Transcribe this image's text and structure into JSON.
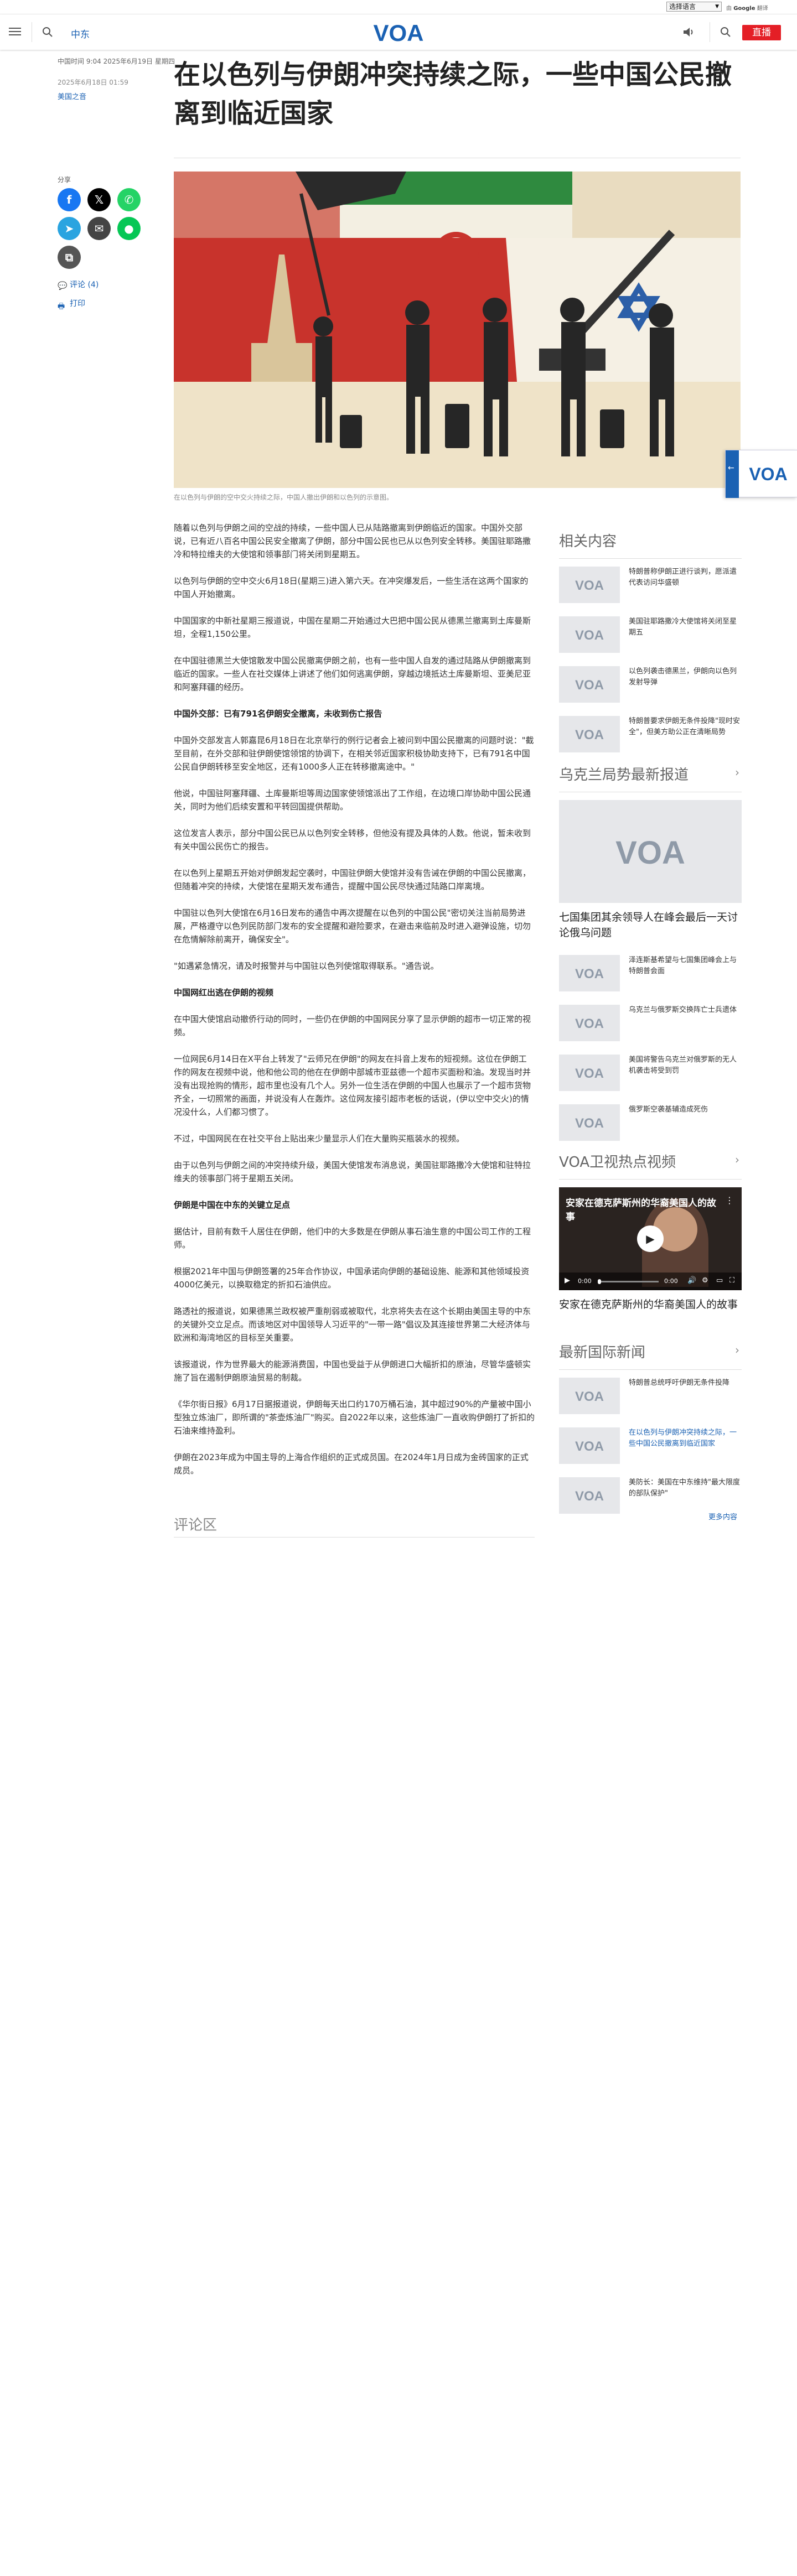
{
  "lang": {
    "selected": "选择语言",
    "powered_by": "Google",
    "translate": "翻译"
  },
  "header": {
    "section": "中东",
    "live": "直播",
    "logo": "VOA"
  },
  "article": {
    "meta_top": "中国时间 9:04 2025年6月19日 星期四",
    "date": "2025年6月18日 01:59",
    "category": "美国之音",
    "title": "在以色列与伊朗冲突持续之际，一些中国公民撤离到临近国家",
    "share_label": "分享",
    "comments_link": "评论 (4)",
    "print_link": "打印",
    "caption": "在以色列与伊朗的空中交火持续之际，中国人撤出伊朗和以色列的示意图。",
    "paragraphs": [
      {
        "type": "p",
        "text": "随着以色列与伊朗之间的空战的持续，一些中国人已从陆路撤离到伊朗临近的国家。中国外交部说，已有近八百名中国公民安全撤离了伊朗，部分中国公民也已从以色列安全转移。美国驻耶路撒冷和特拉维夫的大使馆和领事部门将关闭到星期五。"
      },
      {
        "type": "p",
        "text": "以色列与伊朗的空中交火6月18日(星期三)进入第六天。在冲突爆发后，一些生活在这两个国家的中国人开始撤离。"
      },
      {
        "type": "p",
        "text": "中国国家的中新社星期三报道说，中国在星期二开始通过大巴把中国公民从德黑兰撤离到土库曼斯坦，全程1,150公里。"
      },
      {
        "type": "p",
        "text": "在中国驻德黑兰大使馆散发中国公民撤离伊朗之前，也有一些中国人自发的通过陆路从伊朗撤离到临近的国家。一些人在社交媒体上讲述了他们如何逃离伊朗，穿越边境抵达土库曼斯坦、亚美尼亚和阿塞拜疆的经历。"
      },
      {
        "type": "h",
        "text": "中国外交部：已有791名伊朗安全撤离，未收到伤亡报告"
      },
      {
        "type": "p",
        "text": "中国外交部发言人郭嘉昆6月18日在北京举行的例行记者会上被问到中国公民撤离的问题时说：\"截至目前，在外交部和驻伊朗使馆领馆的协调下，在相关邻近国家积极协助支持下，已有791名中国公民自伊朗转移至安全地区，还有1000多人正在转移撤离途中。\""
      },
      {
        "type": "p",
        "text": "他说，中国驻阿塞拜疆、土库曼斯坦等周边国家使领馆派出了工作组，在边境口岸协助中国公民通关，同时为他们后续安置和平转回国提供帮助。"
      },
      {
        "type": "p",
        "text": "这位发言人表示，部分中国公民已从以色列安全转移，但他没有提及具体的人数。他说，暂未收到有关中国公民伤亡的报告。"
      },
      {
        "type": "p",
        "text": "在以色列上星期五开始对伊朗发起空袭时，中国驻伊朗大使馆并没有告诫在伊朗的中国公民撤离，但随着冲突的持续，大使馆在星期天发布通告，提醒中国公民尽快通过陆路口岸离境。"
      },
      {
        "type": "p",
        "text": "中国驻以色列大使馆在6月16日发布的通告中再次提醒在以色列的中国公民\"密切关注当前局势进展，严格遵守以色列民防部门发布的安全提醒和避险要求，在避击来临前及时进入避弹设施，切勿在危情解除前离开，确保安全\"。"
      },
      {
        "type": "p",
        "text": "\"如遇紧急情况，请及时报警并与中国驻以色列使馆取得联系。\"通告说。"
      },
      {
        "type": "h",
        "text": "中国网红出逃在伊朗的视频"
      },
      {
        "type": "p",
        "text": "在中国大使馆启动撤侨行动的同时，一些仍在伊朗的中国网民分享了显示伊朗的超市一切正常的视频。"
      },
      {
        "type": "p",
        "text": "一位网民6月14日在X平台上转发了\"云师兄在伊朗\"的网友在抖音上发布的短视频。这位在伊朗工作的网友在视频中说，他和他公司的他在在伊朗中部城市亚兹德一个超市买面粉和油。发现当时并没有出现抢购的情形，超市里也没有几个人。另外一位生活在伊朗的中国人也展示了一个超市货物齐全，一切照常的画面，并说没有人在轰炸。这位网友接引超市老板的话说，(伊以空中交火)的情况没什么，人们都习惯了。"
      },
      {
        "type": "p",
        "text": "不过，中国网民在在社交平台上贴出来少量显示人们在大量购买瓶装水的视频。"
      },
      {
        "type": "p",
        "text": "由于以色列与伊朗之间的冲突持续升级，美国大使馆发布消息说，美国驻耶路撒冷大使馆和驻特拉维夫的领事部门将于星期五关闭。"
      },
      {
        "type": "h",
        "text": "伊朗是中国在中东的关键立足点"
      },
      {
        "type": "p",
        "text": "据估计，目前有数千人居住在伊朗，他们中的大多数是在伊朗从事石油生意的中国公司工作的工程师。"
      },
      {
        "type": "p",
        "text": "根据2021年中国与伊朗签署的25年合作协议，中国承诺向伊朗的基础设施、能源和其他领域投资4000亿美元，以换取稳定的折扣石油供应。"
      },
      {
        "type": "p",
        "text": "路透社的报道说，如果德黑兰政权被严重削弱或被取代，北京将失去在这个长期由美国主导的中东的关键外交立足点。而该地区对中国领导人习近平的\"一带一路\"倡议及其连接世界第二大经济体与欧洲和海湾地区的目标至关重要。"
      },
      {
        "type": "p",
        "text": "该报道说，作为世界最大的能源消费国，中国也受益于从伊朗进口大幅折扣的原油，尽管华盛顿实施了旨在遏制伊朗原油贸易的制裁。"
      },
      {
        "type": "p",
        "text": "《华尔街日报》6月17日据报道说，伊朗每天出口约170万桶石油，其中超过90%的产量被中国小型独立炼油厂，即所谓的\"茶壶炼油厂\"购买。自2022年以来，这些炼油厂一直收购伊朗打了折扣的石油来维持盈利。"
      },
      {
        "type": "p",
        "text": "伊朗在2023年成为中国主导的上海合作组织的正式成员国。在2024年1月日成为金砖国家的正式成员。"
      }
    ],
    "comments_title": "评论区"
  },
  "sidebar": {
    "related_title": "相关内容",
    "related": [
      "特朗普称伊朗正进行谈判，愿派遣代表访问华盛顿",
      "美国驻耶路撒冷大使馆将关闭至星期五",
      "以色列袭击德黑兰，伊朗向以色列发射导弹",
      "特朗普要求伊朗无条件投降\"现时安全\"，但美方助公正在清晰局势"
    ],
    "kremlin_title": "乌克兰局势最新报道",
    "kremlin_main": "七国集团其余领导人在峰会最后一天讨论俄乌问题",
    "kremlin_items": [
      "泽连斯基希望与七国集团峰会上与特朗普会面",
      "乌克兰与俄罗斯交换阵亡士兵遗体",
      "美国将警告乌克兰对俄罗斯的无人机袭击将受到罚",
      "俄罗斯空袭基辅造成死伤"
    ],
    "video_title": "VOA卫视热点视频",
    "video_overlay": "安家在德克萨斯州的华裔美国人的故事",
    "video_time": "0:00",
    "video_caption": "安家在德克萨斯州的华裔美国人的故事",
    "news_title": "最新国际新闻",
    "news_items": [
      "特朗普总统呼吁伊朗无条件投降",
      "在以色列与伊朗冲突持续之际，一些中国公民撤离到临近国家",
      "美防长：美国在中东维持\"最大限度的部队保护\""
    ],
    "more": "更多内容"
  },
  "colors": {
    "brand": "#1a61b3",
    "live": "#e41f26"
  }
}
